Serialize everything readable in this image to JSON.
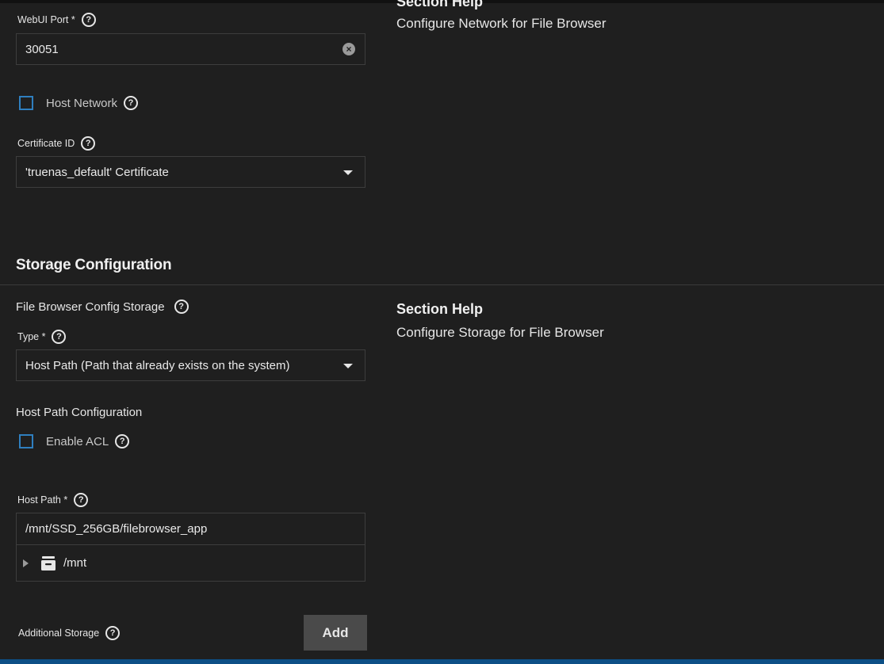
{
  "network": {
    "help_title": "Section Help",
    "help_text": "Configure Network for File Browser",
    "webui_port": {
      "label": "WebUI Port *",
      "value": "30051"
    },
    "host_network": {
      "label": "Host Network",
      "checked": false
    },
    "certificate": {
      "label": "Certificate ID",
      "value": "'truenas_default' Certificate"
    }
  },
  "storage": {
    "title": "Storage Configuration",
    "help_title": "Section Help",
    "help_text": "Configure Storage for File Browser",
    "config_storage_label": "File Browser Config Storage",
    "type": {
      "label": "Type *",
      "value": "Host Path (Path that already exists on the system)"
    },
    "host_path_config_label": "Host Path Configuration",
    "enable_acl": {
      "label": "Enable ACL",
      "checked": false
    },
    "host_path": {
      "label": "Host Path *",
      "value": "/mnt/SSD_256GB/filebrowser_app"
    },
    "tree": {
      "node": "/mnt"
    },
    "additional_storage": {
      "label": "Additional Storage",
      "add_label": "Add"
    }
  },
  "colors": {
    "background": "#1f1f1f",
    "checkbox_border": "#2f7fbf",
    "bottom_bar": "#0d4f86"
  }
}
